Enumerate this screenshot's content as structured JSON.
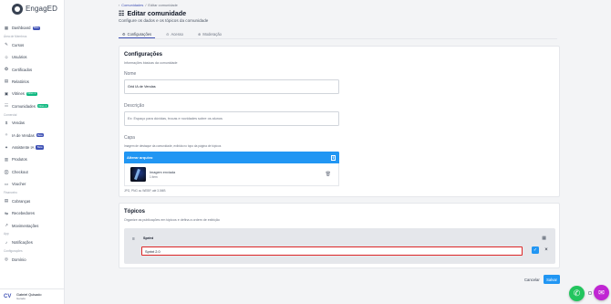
{
  "app": {
    "logo_text": "EngagED"
  },
  "sidebar": {
    "items": [
      {
        "type": "item",
        "icon": "dashboard-icon",
        "glyph": "▦",
        "label": "Dashboard",
        "badge": "Beta"
      },
      {
        "type": "section",
        "label": "Área de Membros"
      },
      {
        "type": "item",
        "icon": "courses-icon",
        "glyph": "✎",
        "label": "Cursos"
      },
      {
        "type": "item",
        "icon": "users-icon",
        "glyph": "☺",
        "label": "Usuários"
      },
      {
        "type": "item",
        "icon": "certificate-icon",
        "glyph": "✪",
        "label": "Certificados"
      },
      {
        "type": "item",
        "icon": "reports-icon",
        "glyph": "▤",
        "label": "Relatórios"
      },
      {
        "type": "item",
        "icon": "showcase-icon",
        "glyph": "▣",
        "label": "Vitrines",
        "badge": "Novo ✦",
        "badge_color": "green"
      },
      {
        "type": "item",
        "icon": "community-icon",
        "glyph": "☷",
        "label": "Comunidades",
        "badge": "Novo ✦",
        "badge_color": "green"
      },
      {
        "type": "section",
        "label": "Comercial"
      },
      {
        "type": "item",
        "icon": "sales-icon",
        "glyph": "$",
        "label": "Vendas"
      },
      {
        "type": "item",
        "icon": "ai-sales-icon",
        "glyph": "✧",
        "label": "IA de Vendas",
        "badge": "Beta"
      },
      {
        "type": "item",
        "icon": "ai-assistant-icon",
        "glyph": "✦",
        "label": "Assistente IA",
        "badge": "Beta"
      },
      {
        "type": "item",
        "icon": "products-icon",
        "glyph": "▥",
        "label": "Produtos"
      },
      {
        "type": "item",
        "icon": "checkout-icon",
        "glyph": "⛒",
        "label": "Checkout"
      },
      {
        "type": "item",
        "icon": "voucher-icon",
        "glyph": "▭",
        "label": "Voucher"
      },
      {
        "type": "section",
        "label": "Financeiro"
      },
      {
        "type": "item",
        "icon": "billing-icon",
        "glyph": "▤",
        "label": "Cobranças"
      },
      {
        "type": "item",
        "icon": "receivables-icon",
        "glyph": "⇆",
        "label": "Recebedores"
      },
      {
        "type": "item",
        "icon": "transactions-icon",
        "glyph": "↗",
        "label": "Movimentações"
      },
      {
        "type": "section",
        "label": "App"
      },
      {
        "type": "item",
        "icon": "notification-icon",
        "glyph": "♪",
        "label": "Notificações"
      },
      {
        "type": "section",
        "label": "Configurações"
      },
      {
        "type": "item",
        "icon": "domain-icon",
        "glyph": "◎",
        "label": "Domínio"
      }
    ],
    "user": {
      "logo": "CV",
      "name": "Gabriel Quisado",
      "role": "Gerado"
    }
  },
  "main": {
    "breadcrumb": {
      "back": "Comunidades",
      "sep": "/",
      "current": "Editar comunidade"
    },
    "title": "Editar comunidade",
    "subtitle": "Configure os dados e os tópicos da comunidade",
    "tabs": [
      {
        "label": "Configurações",
        "active": true,
        "glyph": "⚙"
      },
      {
        "label": "Acesso",
        "active": false,
        "glyph": "⊝"
      },
      {
        "label": "Moderação",
        "active": false,
        "glyph": "⊕"
      }
    ],
    "config_card": {
      "title": "Configurações",
      "subtitle": "Informações básicas da comunidade",
      "name_label": "Nome",
      "name_value": "Grid IA de Vendas",
      "desc_label": "Descrição",
      "desc_value": "Ex: Espaço para dúvidas, trocas e novidades sobre os alunos",
      "cover_label": "Capa",
      "cover_sub": "Imagem de destaque da comunidade, exibida no topo da página de tópicos",
      "upload_label": "Alterar arquivo",
      "file_name": "Imagem enviada",
      "file_size": "1 item",
      "hint": "JPG, PNG ou WEBP, até 3.0MB"
    },
    "topics_card": {
      "title": "Tópicos",
      "subtitle": "Organize as publicações em tópicos e defina a ordem de exibição",
      "topic_name": "Sprint",
      "topic_input_value": "Sprint 2.0"
    },
    "actions": {
      "cancel": "Cancelar",
      "save": "Salvar"
    }
  }
}
